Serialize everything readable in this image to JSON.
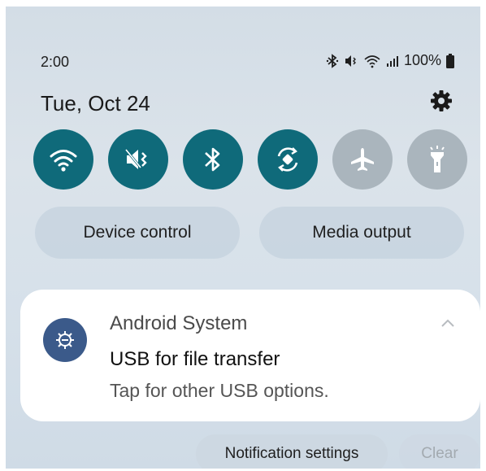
{
  "status_bar": {
    "time": "2:00",
    "battery": "100%",
    "icons": [
      "bluetooth-icon",
      "mute-icon",
      "wifi-icon",
      "signal-icon",
      "battery-icon"
    ]
  },
  "quick_panel": {
    "date": "Tue, Oct 24",
    "settings_icon": "gear-icon",
    "tiles": [
      {
        "name": "wifi",
        "icon": "wifi-icon",
        "state": "on"
      },
      {
        "name": "mute",
        "icon": "mute-icon",
        "state": "on"
      },
      {
        "name": "bluetooth",
        "icon": "bluetooth-icon",
        "state": "on"
      },
      {
        "name": "auto-rotate",
        "icon": "rotate-icon",
        "state": "on"
      },
      {
        "name": "airplane-mode",
        "icon": "airplane-icon",
        "state": "off"
      },
      {
        "name": "flashlight",
        "icon": "flashlight-icon",
        "state": "off"
      }
    ],
    "device_control_label": "Device control",
    "media_output_label": "Media output"
  },
  "notification": {
    "app_name": "Android System",
    "title": "USB for file transfer",
    "text": "Tap for other USB options.",
    "icon": "usb-settings-icon"
  },
  "footer": {
    "notification_settings_label": "Notification settings",
    "clear_label": "Clear"
  },
  "colors": {
    "tile_on": "#0f6a7a",
    "tile_off": "#aab5bd",
    "notif_icon_bg": "#3b5a8a"
  }
}
